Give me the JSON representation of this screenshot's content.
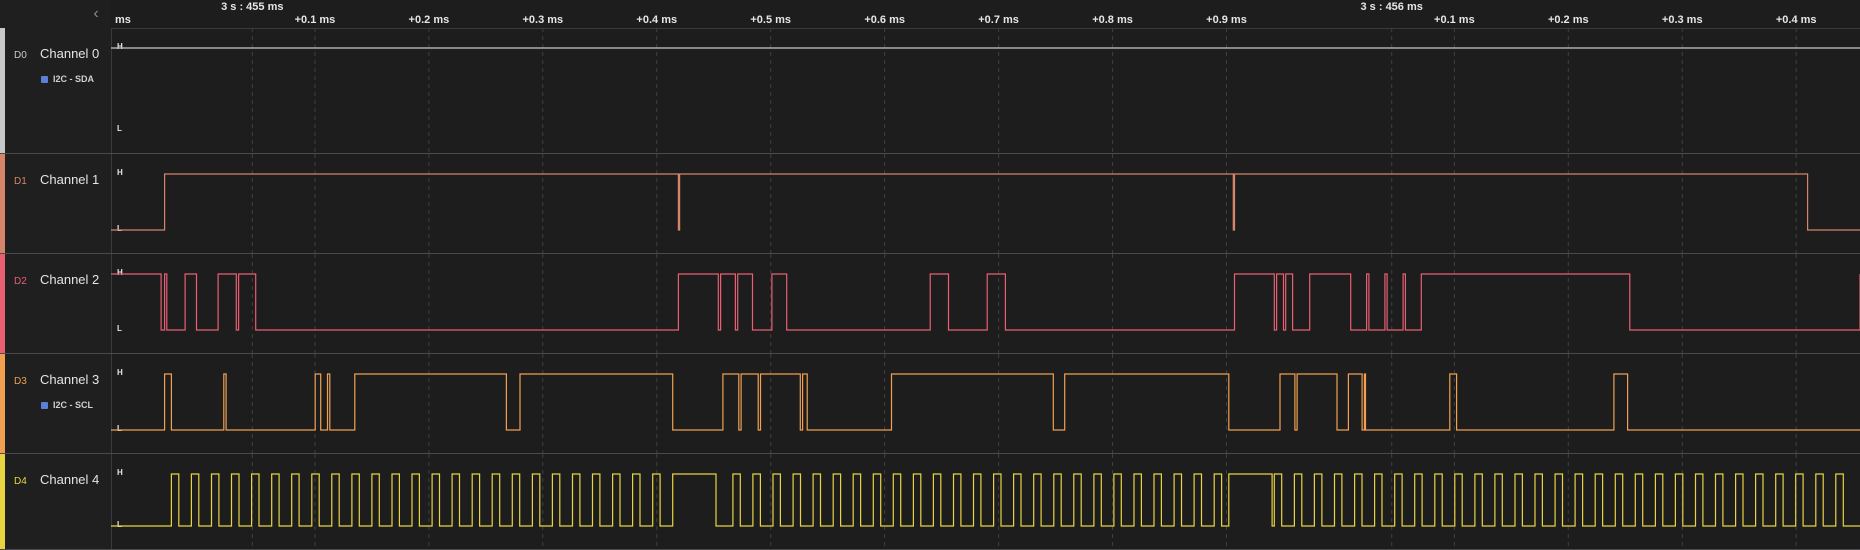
{
  "timeline": {
    "unit_label": "ms",
    "major_labels": [
      {
        "text": "3 s : 455 ms",
        "t": 0.045
      },
      {
        "text": "3 s : 456 ms",
        "t": 1.045
      }
    ],
    "ticks": [
      {
        "text": "+0.1 ms",
        "t": 0.1
      },
      {
        "text": "+0.2 ms",
        "t": 0.2
      },
      {
        "text": "+0.3 ms",
        "t": 0.3
      },
      {
        "text": "+0.4 ms",
        "t": 0.4
      },
      {
        "text": "+0.5 ms",
        "t": 0.5
      },
      {
        "text": "+0.6 ms",
        "t": 0.6
      },
      {
        "text": "+0.7 ms",
        "t": 0.7
      },
      {
        "text": "+0.8 ms",
        "t": 0.8
      },
      {
        "text": "+0.9 ms",
        "t": 0.9
      },
      {
        "text": "+0.1 ms",
        "t": 1.1
      },
      {
        "text": "+0.2 ms",
        "t": 1.2
      },
      {
        "text": "+0.3 ms",
        "t": 1.3
      },
      {
        "text": "+0.4 ms",
        "t": 1.4
      }
    ],
    "view_range_ms": [
      -0.079,
      1.456
    ]
  },
  "level_labels": {
    "high": "H",
    "low": "L"
  },
  "channels": [
    {
      "id": "D0",
      "name": "Channel 0",
      "color": "#c8c8c8",
      "analyzer": "I2C - SDA",
      "initial": 1,
      "transitions": []
    },
    {
      "id": "D1",
      "name": "Channel 1",
      "color": "#d6846a",
      "analyzer": "",
      "initial": 0,
      "transitions": [
        -0.032,
        0.419,
        0.42,
        0.906,
        0.907,
        1.41
      ]
    },
    {
      "id": "D2",
      "name": "Channel 2",
      "color": "#e85f72",
      "analyzer": "",
      "initial": 1,
      "transitions": [
        -0.035,
        -0.032,
        -0.03,
        -0.014,
        -0.004,
        0.015,
        0.031,
        0.033,
        0.048,
        0.419,
        0.454,
        0.456,
        0.469,
        0.471,
        0.484,
        0.501,
        0.514,
        0.64,
        0.656,
        0.69,
        0.706,
        0.907,
        0.942,
        0.944,
        0.95,
        0.952,
        0.958,
        0.973,
        1.009,
        1.023,
        1.025,
        1.039,
        1.041,
        1.055,
        1.057,
        1.071,
        1.254,
        1.46
      ]
    },
    {
      "id": "D3",
      "name": "Channel 3",
      "color": "#f0a050",
      "analyzer": "I2C - SCL",
      "initial": 0,
      "transitions": [
        -0.032,
        -0.026,
        0.02,
        0.022,
        0.105,
        0.111,
        0.113,
        0.135,
        0.268,
        0.28,
        0.414,
        0.458,
        0.472,
        0.474,
        0.489,
        0.491,
        0.526,
        0.528,
        0.532,
        0.606,
        0.748,
        0.758,
        0.902,
        0.947,
        0.96,
        0.962,
        0.997,
        0.1002,
        1.007,
        1.019,
        1.021,
        1.022,
        1.096,
        1.102,
        1.24,
        1.252
      ]
    },
    {
      "id": "D4",
      "name": "Channel 4",
      "color": "#e8d440",
      "analyzer": "",
      "initial": 0,
      "clock": {
        "period_ms": 0.0176,
        "duty_high_ms": 0.0065,
        "start_ms": -0.026
      },
      "gaps": [
        [
          0.414,
          0.452
        ],
        [
          0.902,
          0.94
        ]
      ],
      "end_ms": 1.44
    }
  ]
}
